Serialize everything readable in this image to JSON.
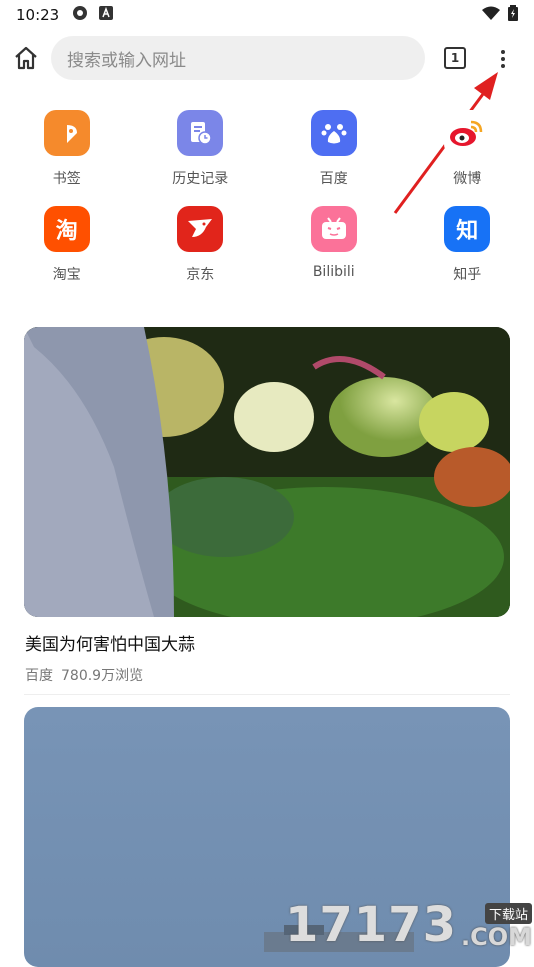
{
  "status_bar": {
    "time": "10:23"
  },
  "toolbar": {
    "search_placeholder": "搜索或输入网址",
    "tab_count": "1"
  },
  "shortcuts": [
    {
      "label": "书签",
      "icon": "bookmark-icon",
      "color": "#f58a2c"
    },
    {
      "label": "历史记录",
      "icon": "history-icon",
      "color": "#7b86e8"
    },
    {
      "label": "百度",
      "icon": "baidu-icon",
      "color": "#4e6ef2"
    },
    {
      "label": "微博",
      "icon": "weibo-icon",
      "color": "#ffffff"
    },
    {
      "label": "淘宝",
      "icon": "taobao-icon",
      "color": "#ff5000",
      "glyph": "淘"
    },
    {
      "label": "京东",
      "icon": "jd-icon",
      "color": "#e1251b"
    },
    {
      "label": "Bilibili",
      "icon": "bilibili-icon",
      "color": "#fb7299"
    },
    {
      "label": "知乎",
      "icon": "zhihu-icon",
      "color": "#1772f6",
      "glyph": "知"
    }
  ],
  "feed": [
    {
      "title": "美国为何害怕中国大蒜",
      "source": "百度",
      "views": "780.9万浏览"
    }
  ],
  "watermark": {
    "number": "17173",
    "tag": "下载站",
    "domain": ".COM"
  }
}
